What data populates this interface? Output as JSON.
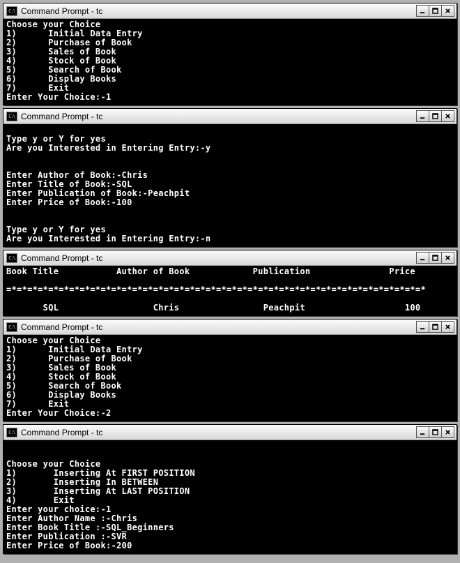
{
  "windows": [
    {
      "title": "Command Prompt - tc",
      "lines": [
        "Choose your Choice",
        "1)      Initial Data Entry",
        "2)      Purchase of Book",
        "3)      Sales of Book",
        "4)      Stock of Book",
        "5)      Search of Book",
        "6)      Display Books",
        "7)      Exit",
        "Enter Your Choice:-1"
      ]
    },
    {
      "title": "Command Prompt - tc",
      "lines": [
        "",
        "Type y or Y for yes",
        "Are you Interested in Entering Entry:-y",
        "",
        "",
        "Enter Author of Book:-Chris",
        "Enter Title of Book:-SQL",
        "Enter Publication of Book:-Peachpit",
        "Enter Price of Book:-100",
        "",
        "",
        "Type y or Y for yes",
        "Are you Interested in Entering Entry:-n"
      ]
    },
    {
      "title": "Command Prompt - tc",
      "lines": [
        "Book Title           Author of Book            Publication               Price",
        "",
        "=*=*=*=*=*=*=*=*=*=*=*=*=*=*=*=*=*=*=*=*=*=*=*=*=*=*=*=*=*=*=*=*=*=*=*=*=*=*=*=*",
        "",
        "       SQL                  Chris                Peachpit                   100"
      ]
    },
    {
      "title": "Command Prompt - tc",
      "lines": [
        "Choose your Choice",
        "1)      Initial Data Entry",
        "2)      Purchase of Book",
        "3)      Sales of Book",
        "4)      Stock of Book",
        "5)      Search of Book",
        "6)      Display Books",
        "7)      Exit",
        "Enter Your Choice:-2"
      ]
    },
    {
      "title": "Command Prompt - tc",
      "lines": [
        "",
        "",
        "Choose your Choice",
        "1)       Inserting At FIRST POSITION",
        "2)       Inserting In BETWEEN",
        "3)       Inserting At LAST POSITION",
        "4)       Exit",
        "Enter your choice:-1",
        "Enter Author Name :-Chris",
        "Enter Book Title :-SQL_Beginners",
        "Enter Publication :-SVR",
        "Enter Price of Book:-200"
      ]
    }
  ]
}
